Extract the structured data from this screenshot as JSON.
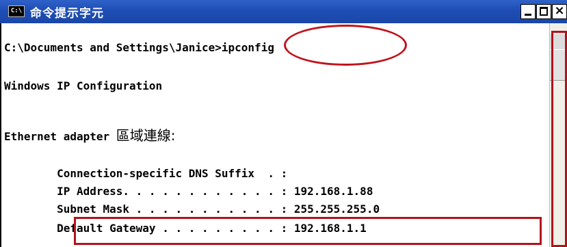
{
  "window": {
    "title": "命令提示字元",
    "icon_text": "C:\\",
    "controls": {
      "minimize": "minimize-icon",
      "maximize": "maximize-icon",
      "close": "×"
    }
  },
  "console": {
    "prompt_path": "C:\\Documents and Settings\\Janice>",
    "command": "ipconfig",
    "header": "Windows IP Configuration",
    "adapter_label": "Ethernet adapter ",
    "adapter_name": "區域連線:",
    "rows": [
      {
        "label": "        Connection-specific DNS Suffix  . :",
        "value": ""
      },
      {
        "label": "        IP Address. . . . . . . . . . . . :",
        "value": " 192.168.1.88"
      },
      {
        "label": "        Subnet Mask . . . . . . . . . . . :",
        "value": " 255.255.255.0"
      },
      {
        "label": "        Default Gateway . . . . . . . . . :",
        "value": " 192.168.1.1"
      }
    ]
  },
  "colors": {
    "titlebar": "#1e4db4",
    "callout": "#b3121a",
    "text": "#000000",
    "background": "#ffffff"
  }
}
